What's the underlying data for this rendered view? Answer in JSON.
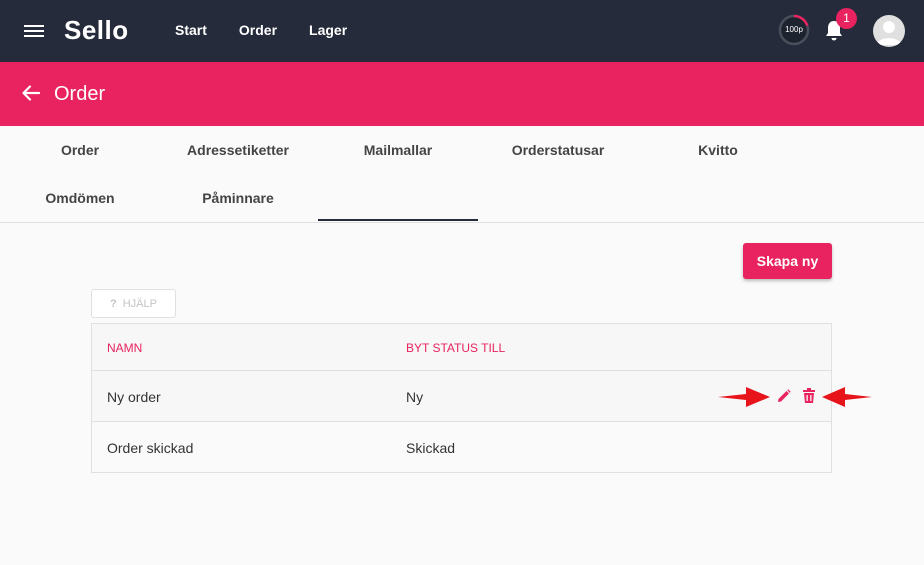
{
  "topbar": {
    "logo": "Sello",
    "nav": [
      "Start",
      "Order",
      "Lager"
    ],
    "gauge_label": "100p",
    "notification_count": "1"
  },
  "header": {
    "title": "Order"
  },
  "tabs": [
    "Order",
    "Adressetiketter",
    "Mailmallar",
    "Orderstatusar",
    "Kvitto",
    "Omdömen",
    "Påminnare"
  ],
  "actions": {
    "create_label": "Skapa ny",
    "help_icon": "?",
    "help_label": "HJÄLP"
  },
  "table": {
    "columns": [
      "NAMN",
      "BYT STATUS TILL"
    ],
    "rows": [
      {
        "name": "Ny order",
        "status": "Ny"
      },
      {
        "name": "Order skickad",
        "status": "Skickad"
      }
    ]
  },
  "colors": {
    "accent": "#e8235f",
    "topbar": "#252b3a",
    "annotation": "#e8141b"
  }
}
